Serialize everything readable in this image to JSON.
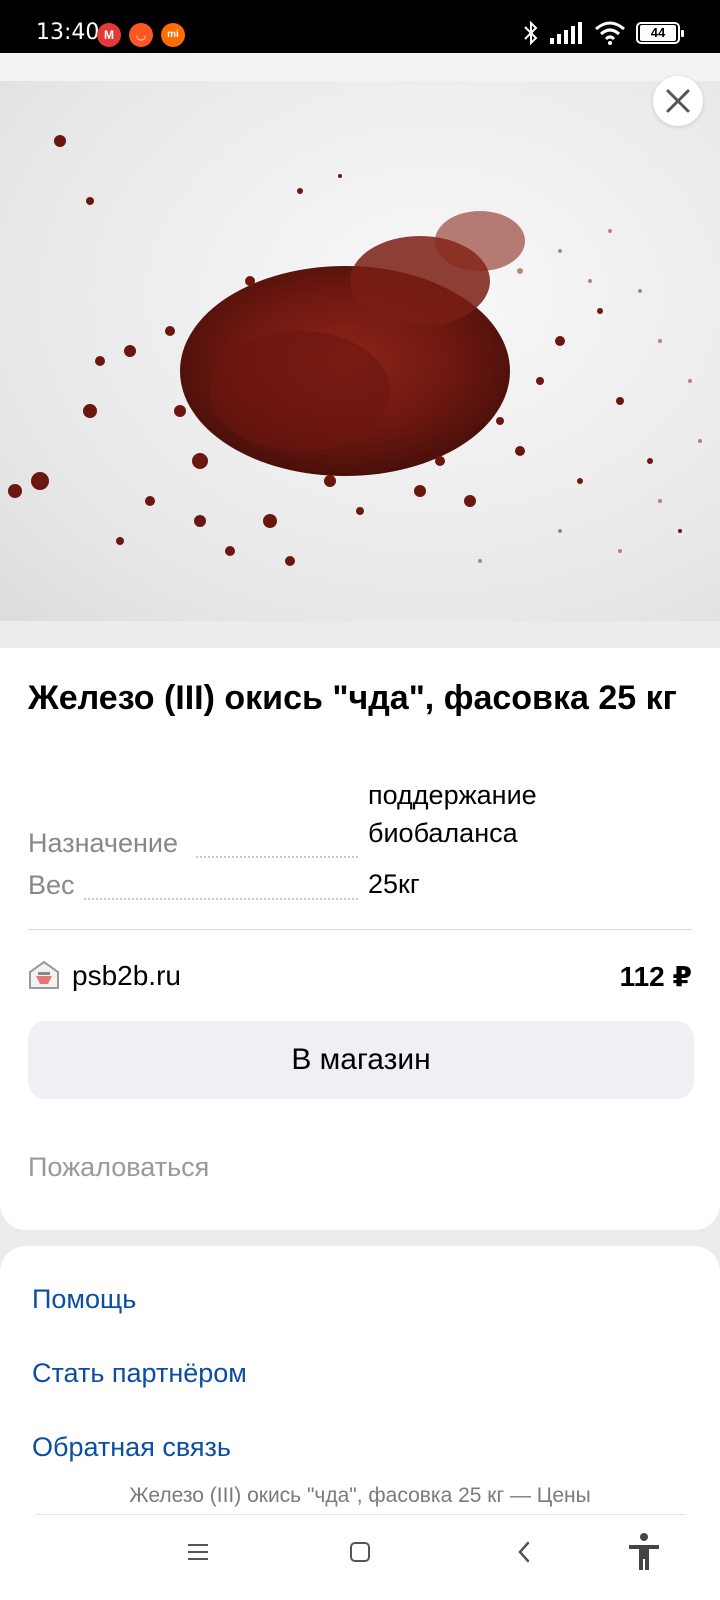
{
  "status_bar": {
    "time": "13:40",
    "battery": "44",
    "notification_icons": [
      "gmail-icon",
      "aliexpress-icon",
      "mi-icon"
    ],
    "system_icons": [
      "bluetooth-icon",
      "signal-icon",
      "wifi-icon",
      "battery-icon"
    ]
  },
  "product": {
    "title": "Железо (III) окись \"чда\", фасовка 25 кг",
    "image_icon": "product-photo",
    "specs": [
      {
        "label": "Назначение",
        "value": "поддержание биобаланса"
      },
      {
        "label": "Вес",
        "value": "25кг"
      }
    ]
  },
  "shop": {
    "name": "psb2b.ru",
    "price": "112 ₽",
    "icon": "shop-logo-icon"
  },
  "actions": {
    "store_button": "В магазин",
    "complain": "Пожаловаться"
  },
  "footer": {
    "links": [
      "Помощь",
      "Стать партнёром",
      "Обратная связь"
    ],
    "caption": "Железо (III) окись \"чда\", фасовка 25 кг — Цены"
  },
  "colors": {
    "link": "#0b4ea2",
    "button_bg": "#eef0f3",
    "muted_text": "#888888",
    "powder": "#7a1a12"
  }
}
